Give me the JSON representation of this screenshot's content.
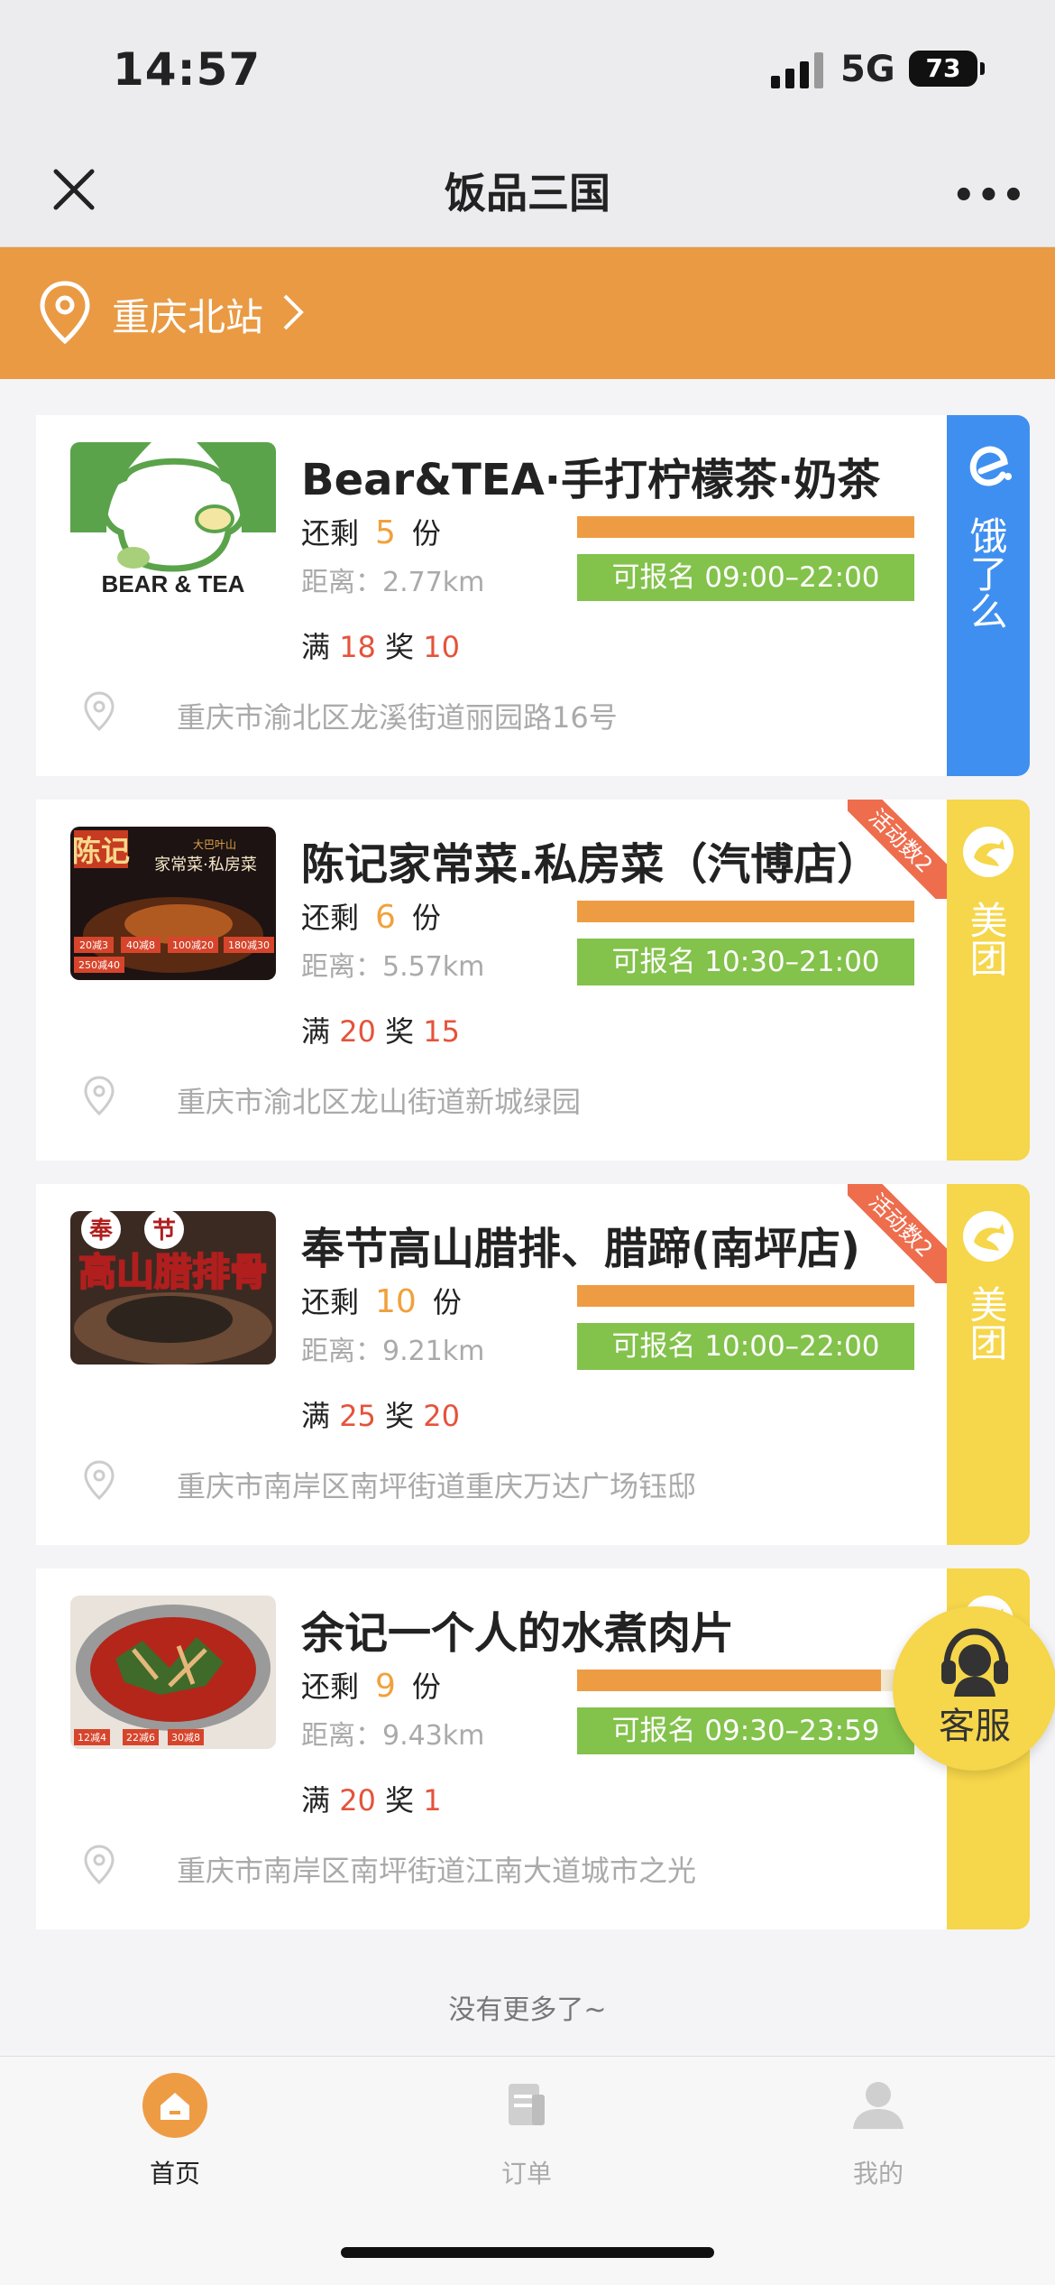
{
  "status": {
    "time": "14:57",
    "network": "5G",
    "battery": "73"
  },
  "nav": {
    "title": "饭品三国"
  },
  "location": {
    "label": "重庆北站"
  },
  "stores": [
    {
      "name": "Bear&TEA·手打柠檬茶·奶茶",
      "remain_label": "还剩",
      "remain": "5",
      "unit": "份",
      "distance": "距离：2.77km",
      "progress": 1.0,
      "signup": "可报名 09:00–22:00",
      "reward_man": "满",
      "reward_man_val": "18",
      "reward_jiang": "奖",
      "reward_jiang_val": "10",
      "address": "重庆市渝北区龙溪街道丽园路16号",
      "platform": "饿了么",
      "platform_icon": "eleme-icon",
      "ribbon": ""
    },
    {
      "name": "陈记家常菜.私房菜（汽博店）",
      "remain_label": "还剩",
      "remain": "6",
      "unit": "份",
      "distance": "距离：5.57km",
      "progress": 1.0,
      "signup": "可报名 10:30–21:00",
      "reward_man": "满",
      "reward_man_val": "20",
      "reward_jiang": "奖",
      "reward_jiang_val": "15",
      "address": "重庆市渝北区龙山街道新城绿园",
      "platform": "美团",
      "platform_icon": "meituan-icon",
      "ribbon": "活动数2"
    },
    {
      "name": "奉节高山腊排、腊蹄(南坪店)",
      "remain_label": "还剩",
      "remain": "10",
      "unit": "份",
      "distance": "距离：9.21km",
      "progress": 1.0,
      "signup": "可报名 10:00–22:00",
      "reward_man": "满",
      "reward_man_val": "25",
      "reward_jiang": "奖",
      "reward_jiang_val": "20",
      "address": "重庆市南岸区南坪街道重庆万达广场钰邸",
      "platform": "美团",
      "platform_icon": "meituan-icon",
      "ribbon": "活动数2"
    },
    {
      "name": "余记一个人的水煮肉片",
      "remain_label": "还剩",
      "remain": "9",
      "unit": "份",
      "distance": "距离：9.43km",
      "progress": 0.9,
      "signup": "可报名 09:30–23:59",
      "reward_man": "满",
      "reward_man_val": "20",
      "reward_jiang": "奖",
      "reward_jiang_val": "1",
      "address": "重庆市南岸区南坪街道江南大道城市之光",
      "platform": "美团",
      "platform_icon": "meituan-icon",
      "ribbon": ""
    }
  ],
  "thumb_labels": {
    "s0": "BEAR & TEA",
    "s1_logo": "陈记",
    "s1_sub": "家常菜·私房菜",
    "s1_top": "大巴叶山",
    "s1_tags": [
      "20减3",
      "40减8",
      "100减20",
      "180减30",
      "250减40"
    ],
    "s2_top1": "奉",
    "s2_top2": "节",
    "s2_main": "高山腊排骨",
    "s3_tags": [
      "12减4",
      "22减6",
      "30减8"
    ]
  },
  "footer": {
    "no_more": "没有更多了~"
  },
  "service": {
    "label": "客服"
  },
  "tabs": [
    {
      "label": "首页",
      "icon": "home-icon",
      "active": true
    },
    {
      "label": "订单",
      "icon": "order-icon",
      "active": false
    },
    {
      "label": "我的",
      "icon": "profile-icon",
      "active": false
    }
  ],
  "colors": {
    "accent": "#e99a43",
    "green": "#83c24b",
    "red": "#e5533b",
    "eleme": "#3f8ff0",
    "meituan": "#f6d64a"
  }
}
